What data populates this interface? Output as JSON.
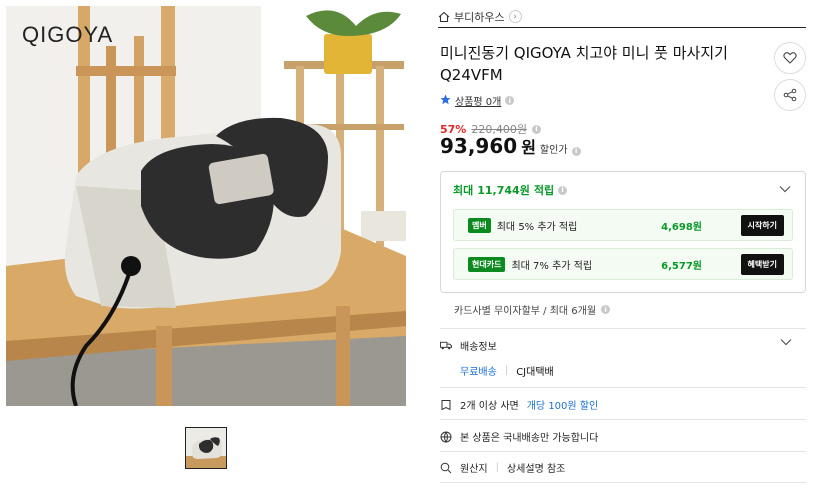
{
  "gallery": {
    "brand_logo": "QIGOYA",
    "main_image_alt": "foot massager on wooden chair",
    "thumbnail_alt": "foot massager thumbnail"
  },
  "store": {
    "name": "부디하우스",
    "icon": "home-icon"
  },
  "product": {
    "title": "미니진동기 QIGOYA 치고야 미니 풋 마사지기 Q24VFM",
    "review_label": "상품평 0개",
    "discount_rate": "57%",
    "original_price": "220,400원",
    "sale_price": "93,960",
    "price_unit": "원",
    "price_label": "할인가"
  },
  "actions": {
    "wishlist_icon": "heart-icon",
    "share_icon": "share-icon"
  },
  "benefits": {
    "headline_prefix": "최대",
    "headline_amount": "11,744원",
    "headline_suffix": "적립",
    "cards": [
      {
        "badge": "멤버",
        "text": "최대 5% 추가 적립",
        "amount": "4,698원",
        "button": "시작하기"
      },
      {
        "badge": "현대카드",
        "text": "최대 7% 추가 적립",
        "amount": "6,577원",
        "button": "혜택받기"
      }
    ]
  },
  "installment": "카드사별 무이자할부 / 최대 6개월",
  "shipping": {
    "label": "배송정보",
    "free": "무료배송",
    "carrier": "CJ대택배"
  },
  "promo": {
    "prefix": "2개 이상 사면",
    "highlight": "개당 100원 할인"
  },
  "domestic": "본 상품은 국내배송만 가능합니다",
  "origin": {
    "label": "원산지",
    "value": "상세설명 참조"
  },
  "colors": {
    "discount": "#e22a2a",
    "benefit_green": "#0a9a2a",
    "link_blue": "#1a6fd6"
  }
}
